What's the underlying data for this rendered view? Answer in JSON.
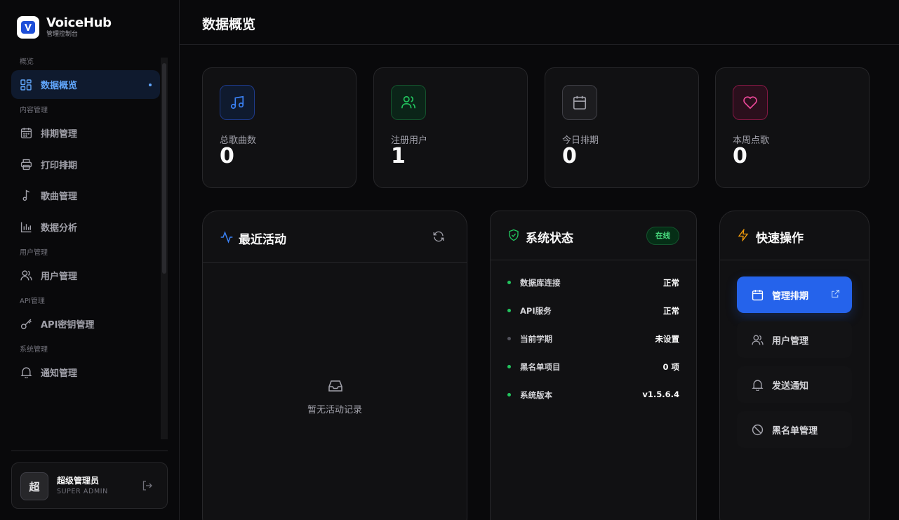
{
  "brand": {
    "name": "VoiceHub",
    "subtitle": "管理控制台"
  },
  "sidebar": {
    "sections": [
      {
        "title": "概览",
        "items": [
          {
            "label": "数据概览",
            "icon": "dashboard-icon",
            "active": true
          }
        ]
      },
      {
        "title": "内容管理",
        "items": [
          {
            "label": "排期管理",
            "icon": "calendar-icon"
          },
          {
            "label": "打印排期",
            "icon": "printer-icon"
          },
          {
            "label": "歌曲管理",
            "icon": "music-note-icon"
          },
          {
            "label": "数据分析",
            "icon": "bar-chart-icon"
          }
        ]
      },
      {
        "title": "用户管理",
        "items": [
          {
            "label": "用户管理",
            "icon": "users-icon"
          }
        ]
      },
      {
        "title": "API管理",
        "items": [
          {
            "label": "API密钥管理",
            "icon": "key-icon"
          }
        ]
      },
      {
        "title": "系统管理",
        "items": [
          {
            "label": "通知管理",
            "icon": "bell-icon"
          }
        ]
      }
    ],
    "user": {
      "avatar": "超",
      "name": "超级管理员",
      "role": "SUPER ADMIN"
    }
  },
  "header": {
    "title": "数据概览"
  },
  "stats": [
    {
      "label": "总歌曲数",
      "value": "0",
      "icon": "music-icon",
      "color": "#3b82f6"
    },
    {
      "label": "注册用户",
      "value": "1",
      "icon": "users-icon",
      "color": "#22c55e"
    },
    {
      "label": "今日排期",
      "value": "0",
      "icon": "calendar-icon",
      "color": "#a1a1aa"
    },
    {
      "label": "本周点歌",
      "value": "0",
      "icon": "heart-icon",
      "color": "#ec4899"
    }
  ],
  "activity": {
    "title": "最近活动",
    "empty": "暂无活动记录"
  },
  "system": {
    "title": "系统状态",
    "badge": "在线",
    "rows": [
      {
        "label": "数据库连接",
        "value": "正常",
        "ok": true
      },
      {
        "label": "API服务",
        "value": "正常",
        "ok": true
      },
      {
        "label": "当前学期",
        "value": "未设置",
        "ok": false
      },
      {
        "label": "黑名单项目",
        "value": "0 项",
        "ok": true
      },
      {
        "label": "系统版本",
        "value": "v1.5.6.4",
        "ok": true
      }
    ]
  },
  "quick": {
    "title": "快速操作",
    "actions": [
      {
        "label": "管理排期",
        "icon": "calendar-icon"
      },
      {
        "label": "用户管理",
        "icon": "users-icon"
      },
      {
        "label": "发送通知",
        "icon": "bell-icon"
      },
      {
        "label": "黑名单管理",
        "icon": "ban-icon"
      }
    ]
  },
  "colors": {
    "accent": "#2563eb",
    "active_text": "#60a5fa",
    "ok": "#22c55e",
    "background": "#09090b",
    "card": "#111113"
  }
}
